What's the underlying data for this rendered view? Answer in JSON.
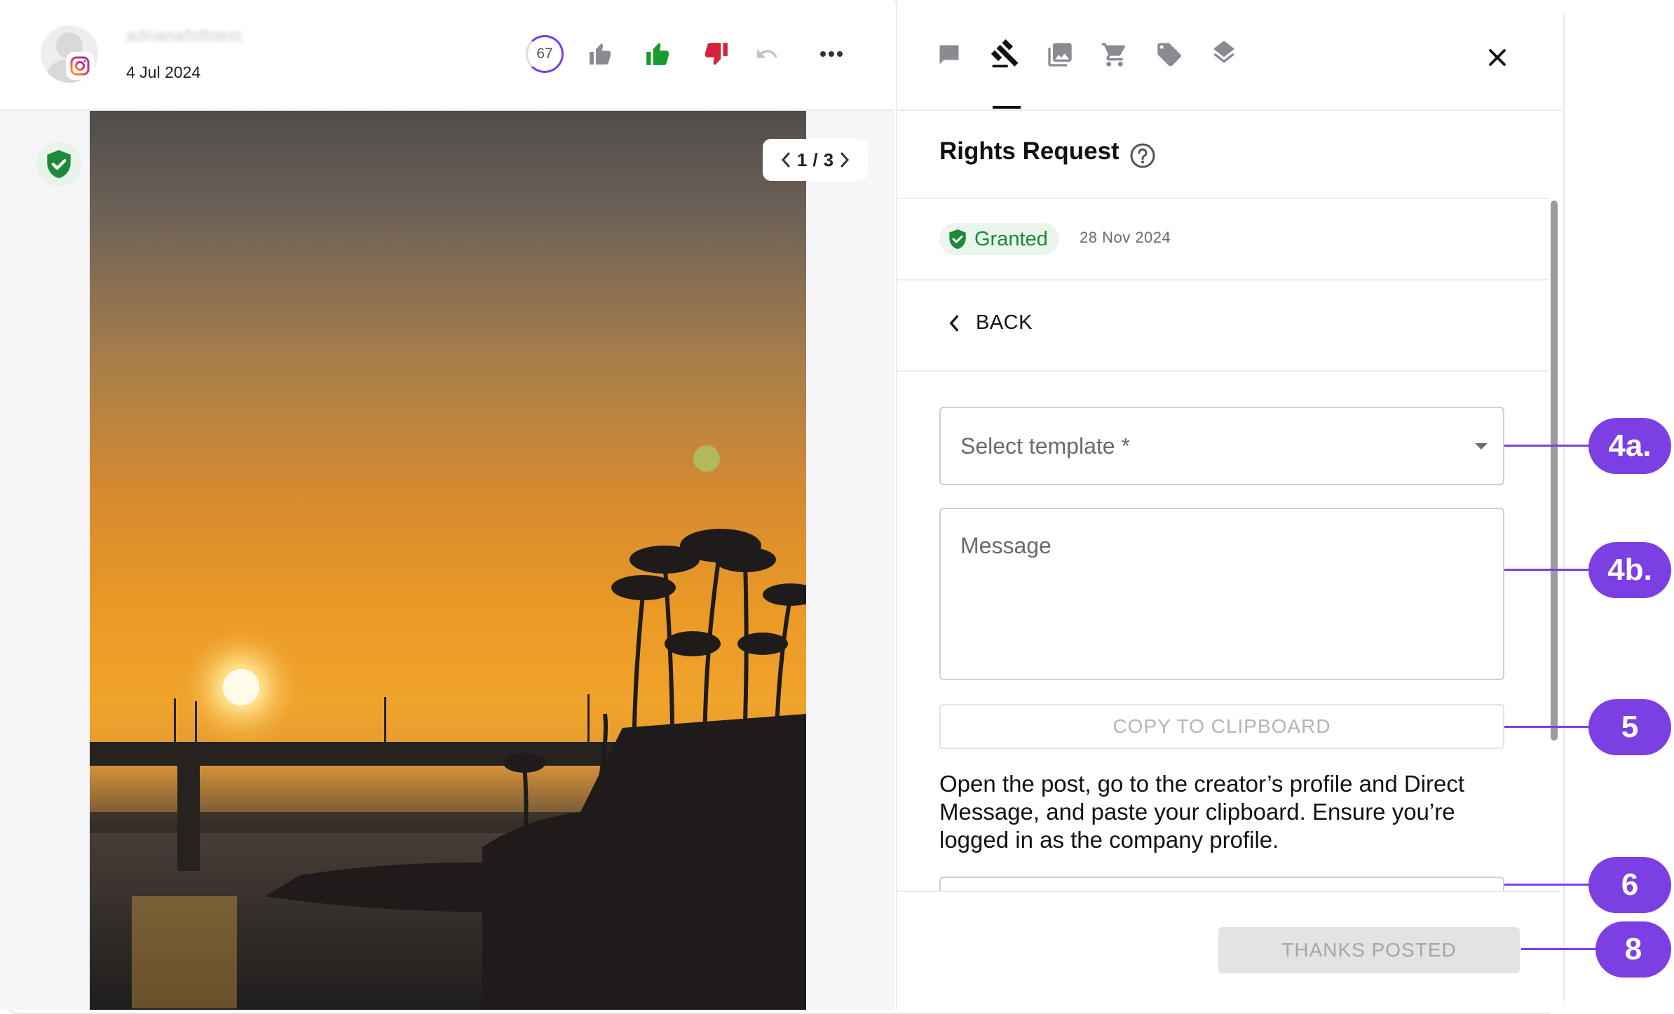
{
  "post": {
    "username": "adrianafsfbtest",
    "date": "4 Jul 2024",
    "score": "67",
    "pager": {
      "current": "1",
      "separator": "/",
      "total": "3"
    }
  },
  "panel": {
    "tabs": [
      {
        "name": "comments",
        "icon": "comment-icon"
      },
      {
        "name": "rights",
        "icon": "gavel-icon",
        "active": true
      },
      {
        "name": "media",
        "icon": "image-icon"
      },
      {
        "name": "shop",
        "icon": "cart-icon"
      },
      {
        "name": "tags",
        "icon": "tag-icon"
      },
      {
        "name": "layers",
        "icon": "layers-icon"
      }
    ],
    "title": "Rights Request",
    "status": {
      "label": "Granted",
      "date": "28 Nov 2024",
      "color": "#1c8a37"
    },
    "back_label": "BACK",
    "template_placeholder": "Select template *",
    "message_placeholder": "Message",
    "copy_label": "COPY TO CLIPBOARD",
    "instructions": "Open the post, go to the creator’s profile and Direct Message, and paste your clipboard. Ensure you’re logged in as the company profile.",
    "thanks_label": "THANKS POSTED"
  },
  "callouts": [
    "4a.",
    "4b.",
    "5",
    "6",
    "8"
  ],
  "colors": {
    "accent": "#7b3fe4",
    "like_green": "#1a9a2c",
    "dislike_red": "#d3243b",
    "granted_green": "#1c8a37"
  }
}
